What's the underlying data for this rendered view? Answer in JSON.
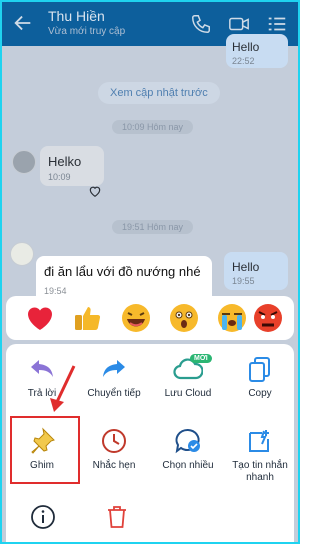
{
  "header": {
    "contact_name": "Thu Hiền",
    "status": "Vừa mới truy cập"
  },
  "messages": {
    "top_right": {
      "text": "Hello",
      "time": "22:52"
    },
    "load_prev": "Xem cập nhật trước",
    "sep1": "10:09 Hôm nay",
    "left1": {
      "text": "Helko",
      "time": "10:09"
    },
    "sep2": "19:51 Hôm nay",
    "highlighted": {
      "text": "đi ăn lẩu với đồ nướng nhé",
      "time": "19:54"
    },
    "right2": {
      "text": "Hello",
      "time": "19:55"
    }
  },
  "reactions": [
    "heart-emoji",
    "thumbs-up-emoji",
    "laugh-emoji",
    "surprised-emoji",
    "crying-emoji",
    "angry-emoji"
  ],
  "actions": {
    "reply": "Trả lời",
    "forward": "Chuyển tiếp",
    "save_cloud": "Lưu Cloud",
    "new_badge": "MỚI",
    "copy": "Copy",
    "pin": "Ghim",
    "remind": "Nhắc hẹn",
    "multi_select": "Chọn nhiều",
    "quick_message": "Tạo tin nhắn nhanh"
  },
  "colors": {
    "header": "#0d5f9c",
    "accent": "#1a8be3",
    "highlight_box": "#e02d2d"
  }
}
